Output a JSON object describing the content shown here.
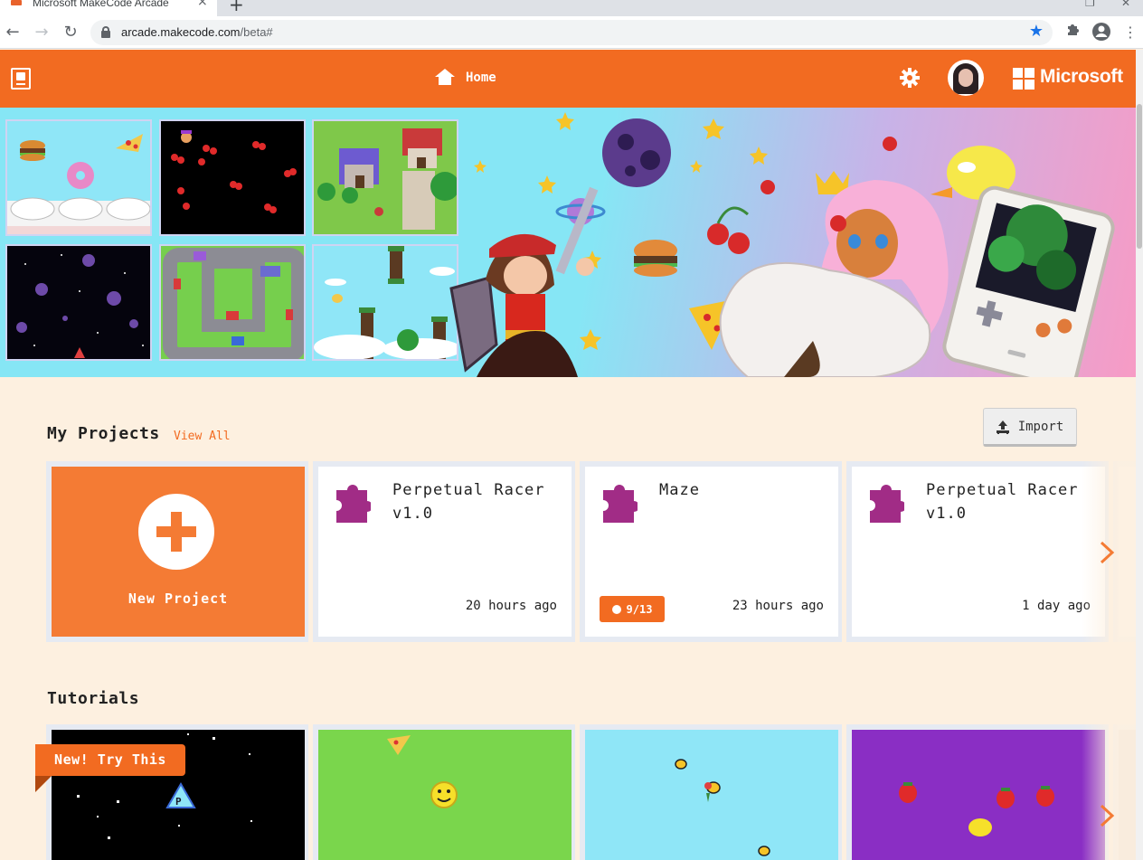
{
  "browser": {
    "tab_title": "Microsoft MakeCode Arcade",
    "tab_close": "×",
    "new_tab": "+",
    "url_host": "arcade.makecode.com",
    "url_path": "/beta#",
    "bookmark_star": "★"
  },
  "header": {
    "home_label": "Home",
    "brand": "Microsoft",
    "colors": {
      "header_bg": "#f26b21",
      "page_bg": "#fdf0e0"
    }
  },
  "my_projects": {
    "title": "My Projects",
    "view_all": "View All",
    "import_label": "Import",
    "new_project_label": "New Project",
    "projects": [
      {
        "name": "Perpetual Racer v1.0",
        "time": "20 hours ago"
      },
      {
        "name": "Maze",
        "time": "23 hours ago",
        "badge": "9/13"
      },
      {
        "name": "Perpetual Racer v1.0",
        "time": "1 day ago"
      }
    ]
  },
  "tutorials": {
    "title": "Tutorials",
    "ribbon": "New! Try This"
  }
}
